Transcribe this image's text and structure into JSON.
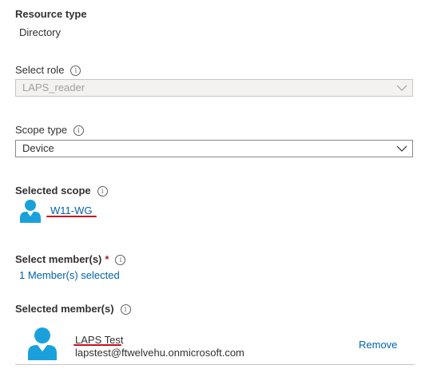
{
  "resource_type": {
    "label": "Resource type",
    "value": "Directory"
  },
  "select_role": {
    "label": "Select role",
    "value": "LAPS_reader"
  },
  "scope_type": {
    "label": "Scope type",
    "value": "Device"
  },
  "selected_scope": {
    "label": "Selected scope",
    "name": "W11-WG"
  },
  "select_members": {
    "label": "Select member(s)",
    "required_mark": "*",
    "selection_text": "1 Member(s) selected"
  },
  "selected_members": {
    "label": "Selected member(s)",
    "items": [
      {
        "name": "LAPS Test",
        "email": "lapstest@ftwelvehu.onmicrosoft.com",
        "remove_label": "Remove"
      }
    ]
  },
  "info_glyph": "i",
  "colors": {
    "link": "#0062ad",
    "annotation": "#c50f1f",
    "avatar": "#1aa1dc",
    "required": "#a4262c"
  }
}
